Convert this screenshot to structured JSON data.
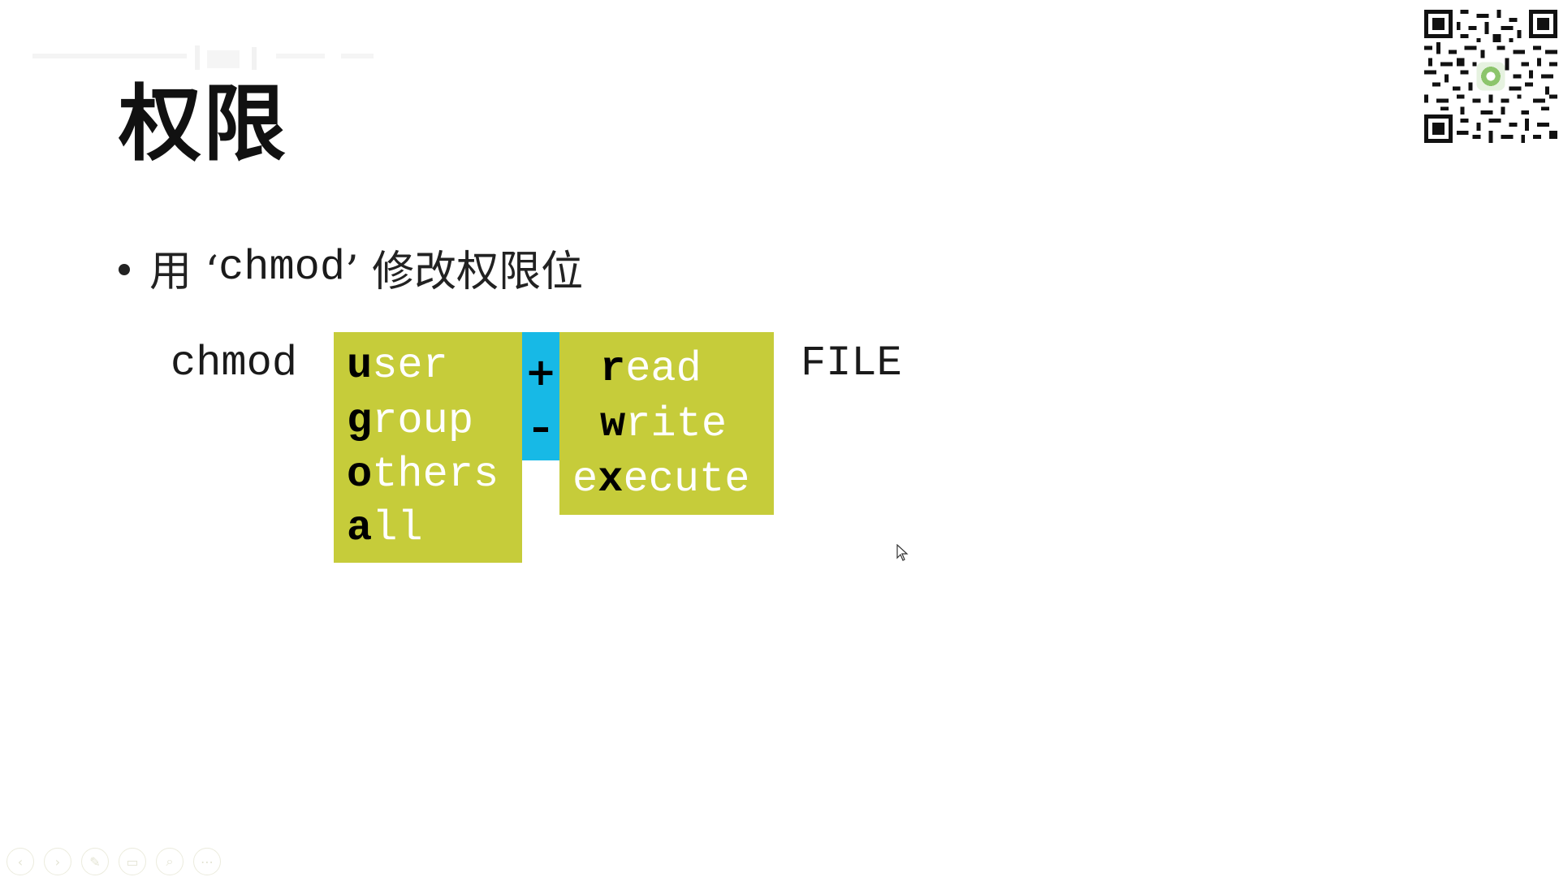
{
  "slide": {
    "title": "权限",
    "bullet": {
      "prefix": "用 ‘",
      "code": "chmod",
      "suffix": "’ 修改权限位"
    },
    "diagram": {
      "command": "chmod",
      "target": "FILE",
      "who": [
        {
          "key": "u",
          "rest": "ser"
        },
        {
          "key": "g",
          "rest": "roup"
        },
        {
          "key": "o",
          "rest": "thers"
        },
        {
          "key": "a",
          "rest": "ll"
        }
      ],
      "operators": [
        "+",
        "–"
      ],
      "permissions": [
        {
          "pre": "",
          "key": "r",
          "rest": "ead"
        },
        {
          "pre": "",
          "key": "w",
          "rest": "rite"
        },
        {
          "pre": "e",
          "key": "x",
          "rest": "ecute"
        }
      ]
    }
  },
  "colors": {
    "green_box": "#c6cc3a",
    "blue_box": "#17b9e6",
    "text": "#111111"
  },
  "icons": {
    "qr": "qr-code-icon",
    "cursor": "mouse-pointer-icon",
    "nav": [
      "previous-icon",
      "next-icon",
      "pen-icon",
      "slides-icon",
      "zoom-icon",
      "more-icon"
    ]
  }
}
